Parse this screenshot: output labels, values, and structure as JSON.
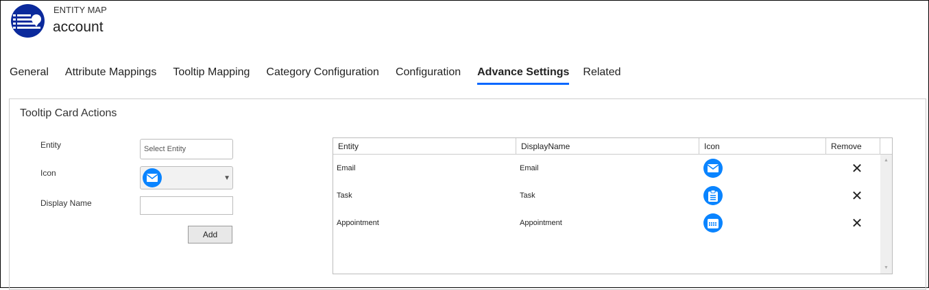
{
  "header": {
    "eyebrow": "ENTITY MAP",
    "title": "account"
  },
  "tabs": [
    {
      "label": "General"
    },
    {
      "label": "Attribute Mappings"
    },
    {
      "label": "Tooltip Mapping"
    },
    {
      "label": "Category Configuration"
    },
    {
      "label": "Configuration"
    },
    {
      "label": "Advance Settings",
      "active": true
    },
    {
      "label": "Related"
    }
  ],
  "panel": {
    "title": "Tooltip Card Actions",
    "form": {
      "entity_label": "Entity",
      "entity_placeholder": "Select Entity",
      "icon_label": "Icon",
      "icon_value": "email-icon",
      "display_name_label": "Display Name",
      "display_name_value": "",
      "add_label": "Add"
    },
    "grid": {
      "columns": [
        "Entity",
        "DisplayName",
        "Icon",
        "Remove"
      ],
      "rows": [
        {
          "entity": "Email",
          "display": "Email",
          "icon": "email-icon",
          "remove": "✕"
        },
        {
          "entity": "Task",
          "display": "Task",
          "icon": "clipboard-icon",
          "remove": "✕"
        },
        {
          "entity": "Appointment",
          "display": "Appointment",
          "icon": "calendar-icon",
          "remove": "✕"
        }
      ]
    }
  },
  "colors": {
    "accent": "#0066ff",
    "icon": "#0a84ff",
    "logo": "#0b2a9c"
  }
}
